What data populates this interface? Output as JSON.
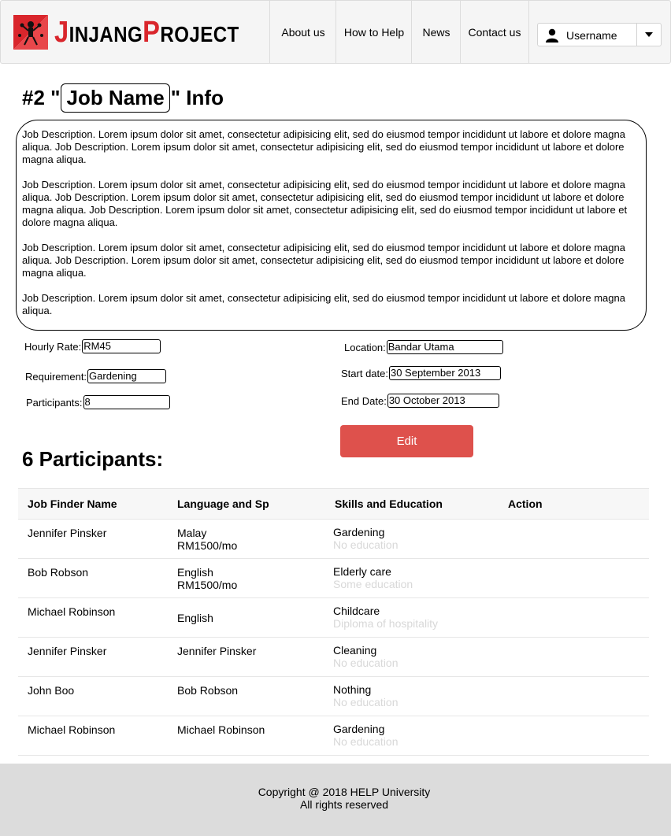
{
  "nav": {
    "brand": "JinjangProject",
    "brand_parts": [
      "J",
      "INJANG",
      "P",
      "ROJECT"
    ],
    "items": [
      {
        "label": "About us"
      },
      {
        "label": "How to Help"
      },
      {
        "label": "News"
      },
      {
        "label": "Contact us"
      }
    ],
    "user": {
      "label": "Username",
      "icon": "user-icon"
    }
  },
  "job": {
    "title_prefix": "#2 \"",
    "name": "Job Name",
    "title_suffix": "\" Info",
    "description": [
      "Job Description. Lorem ipsum dolor sit amet, consectetur adipisicing elit, sed do eiusmod tempor incididunt ut labore et dolore magna aliqua. Job Description. Lorem ipsum dolor sit amet, consectetur adipisicing elit, sed do eiusmod tempor incididunt ut labore et dolore magna aliqua.",
      " Job Description. Lorem ipsum dolor sit amet, consectetur adipisicing elit, sed do eiusmod tempor incididunt ut labore et dolore magna aliqua. Job Description. Lorem ipsum dolor sit amet, consectetur adipisicing elit, sed do eiusmod tempor incididunt ut labore et dolore magna aliqua. Job Description. Lorem ipsum dolor sit amet, consectetur adipisicing elit, sed do eiusmod tempor incididunt ut labore et dolore magna aliqua.",
      "Job Description. Lorem ipsum dolor sit amet, consectetur adipisicing elit, sed do eiusmod tempor incididunt ut labore et dolore magna aliqua. Job Description. Lorem ipsum dolor sit amet, consectetur adipisicing elit, sed do eiusmod tempor incididunt ut labore et dolore magna aliqua.",
      "Job Description. Lorem ipsum dolor sit amet, consectetur adipisicing elit, sed do eiusmod tempor incididunt ut labore et dolore magna aliqua."
    ],
    "fields": {
      "hourly_rate": {
        "label": "Hourly Rate:",
        "value": "RM45"
      },
      "requirement": {
        "label": "Requirement:",
        "value": "Gardening"
      },
      "participants": {
        "label": "Participants:",
        "value": "8"
      },
      "location": {
        "label": "Location:",
        "value": "Bandar Utama"
      },
      "start_date": {
        "label": "Start date:",
        "value": "30 September 2013"
      },
      "end_date": {
        "label": "End Date:",
        "value": "30 October 2013"
      }
    },
    "edit_label": "Edit"
  },
  "participants": {
    "title": "6 Participants:",
    "columns": [
      "Job Finder Name",
      "Language and Sp",
      "Skills and Education",
      "Action"
    ],
    "rows": [
      {
        "name": "Jennifer Pinsker",
        "lang": "Malay",
        "pay": "RM1500/mo",
        "skill": "Gardening",
        "edu": "No education"
      },
      {
        "name": "Bob Robson",
        "lang": "English",
        "pay": "RM1500/mo",
        "skill": "Elderly care",
        "edu": "Some education"
      },
      {
        "name": "Michael Robinson",
        "lang": "English",
        "pay": "",
        "skill": "Childcare",
        "edu": "Diploma of hospitality"
      },
      {
        "name": "Jennifer Pinsker",
        "lang": "Jennifer Pinsker",
        "pay": "",
        "skill": "Cleaning",
        "edu": "No education"
      },
      {
        "name": "John Boo",
        "lang": "Bob Robson",
        "pay": "",
        "skill": "Nothing",
        "edu": "No education"
      },
      {
        "name": "Michael Robinson",
        "lang": "Michael Robinson",
        "pay": "",
        "skill": "Gardening",
        "edu": "No education"
      }
    ]
  },
  "footer": {
    "copyright": "Copyright @ 2018 HELP University",
    "rights": "All rights reserved"
  },
  "colors": {
    "brand_red": "#d9262c",
    "edit_button": "#de514c",
    "footer_bg": "#dcdcdc",
    "muted_text": "#d8d8d8"
  }
}
